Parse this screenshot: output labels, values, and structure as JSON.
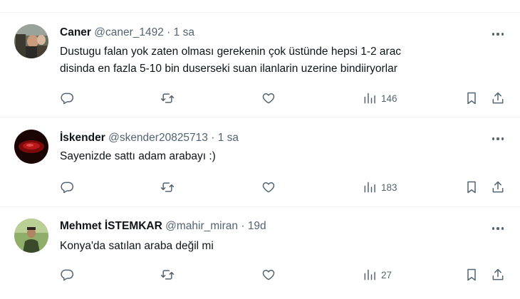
{
  "replies": [
    {
      "name": "Caner",
      "handle": "@caner_1492",
      "separator": "·",
      "time": "1 sa",
      "text_line1": "Dustugu falan yok zaten olması gerekenin çok üstünde hepsi 1-2 arac",
      "text_line2": "disinda en fazla 5-10 bin duserseki suan ilanlarin uzerine bindiiryorlar",
      "views": "146"
    },
    {
      "name": "İskender",
      "handle": "@skender20825713",
      "separator": "·",
      "time": "1 sa",
      "text_line1": "Sayenizde sattı adam arabayı :)",
      "views": "183"
    },
    {
      "name": "Mehmet İSTEMKAR",
      "handle": "@mahir_miran",
      "separator": "·",
      "time": "19d",
      "text_line1": "Konya'da satılan araba değil mi",
      "views": "27"
    }
  ],
  "icons": {
    "reply": "reply-icon",
    "retweet": "retweet-icon",
    "like": "heart-icon",
    "views": "views-icon",
    "bookmark": "bookmark-icon",
    "share": "share-icon",
    "more": "more-icon"
  },
  "colors": {
    "text": "#0f1419",
    "secondary": "#536471",
    "divider": "#eff3f4"
  }
}
